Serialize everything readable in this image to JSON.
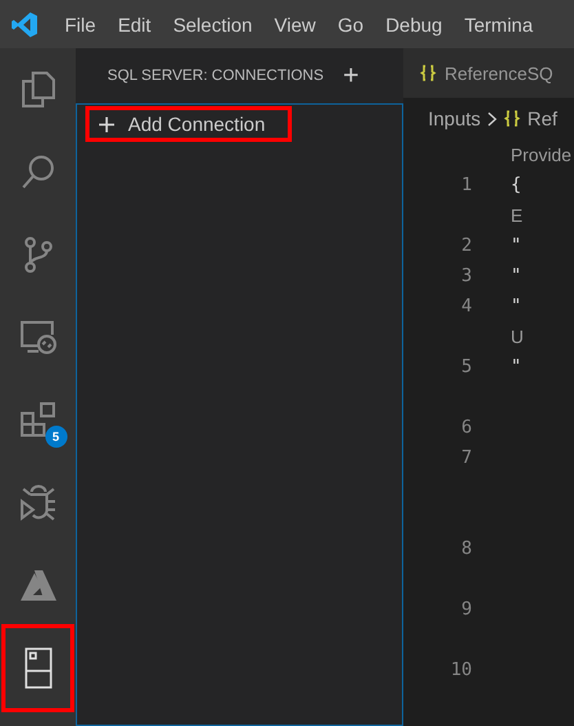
{
  "menu_bar": {
    "items": [
      "File",
      "Edit",
      "Selection",
      "View",
      "Go",
      "Debug",
      "Termina"
    ]
  },
  "activity_bar": {
    "items": [
      {
        "kind": "files",
        "highlighted": false
      },
      {
        "kind": "search",
        "highlighted": false
      },
      {
        "kind": "source-control",
        "highlighted": false
      },
      {
        "kind": "remote",
        "highlighted": false
      },
      {
        "kind": "extensions",
        "highlighted": false,
        "badge": "5"
      },
      {
        "kind": "debug",
        "highlighted": false
      },
      {
        "kind": "azure",
        "highlighted": false
      },
      {
        "kind": "sql-server",
        "highlighted": true
      }
    ]
  },
  "sidebar": {
    "title": "SQL SERVER: CONNECTIONS",
    "add_symbol": "+",
    "items": [
      {
        "label": "Add Connection",
        "highlighted": true
      }
    ]
  },
  "editor": {
    "tab": {
      "label": "ReferenceSQ"
    },
    "breadcrumb": [
      "Inputs",
      "Ref"
    ],
    "rows": [
      {
        "kind": "lens",
        "text": "Provide"
      },
      {
        "kind": "line",
        "number": "1",
        "text": "{"
      },
      {
        "kind": "lens",
        "text": "E"
      },
      {
        "kind": "line",
        "number": "2",
        "text": "\""
      },
      {
        "kind": "line",
        "number": "3",
        "text": "\""
      },
      {
        "kind": "line",
        "number": "4",
        "text": "\""
      },
      {
        "kind": "lens",
        "text": "U"
      },
      {
        "kind": "line",
        "number": "5",
        "text": "\""
      },
      {
        "kind": "gap"
      },
      {
        "kind": "line",
        "number": "6"
      },
      {
        "kind": "line",
        "number": "7"
      },
      {
        "kind": "gap"
      },
      {
        "kind": "gap"
      },
      {
        "kind": "line",
        "number": "8"
      },
      {
        "kind": "gap"
      },
      {
        "kind": "line",
        "number": "9"
      },
      {
        "kind": "gap"
      },
      {
        "kind": "line",
        "number": "10"
      }
    ]
  }
}
